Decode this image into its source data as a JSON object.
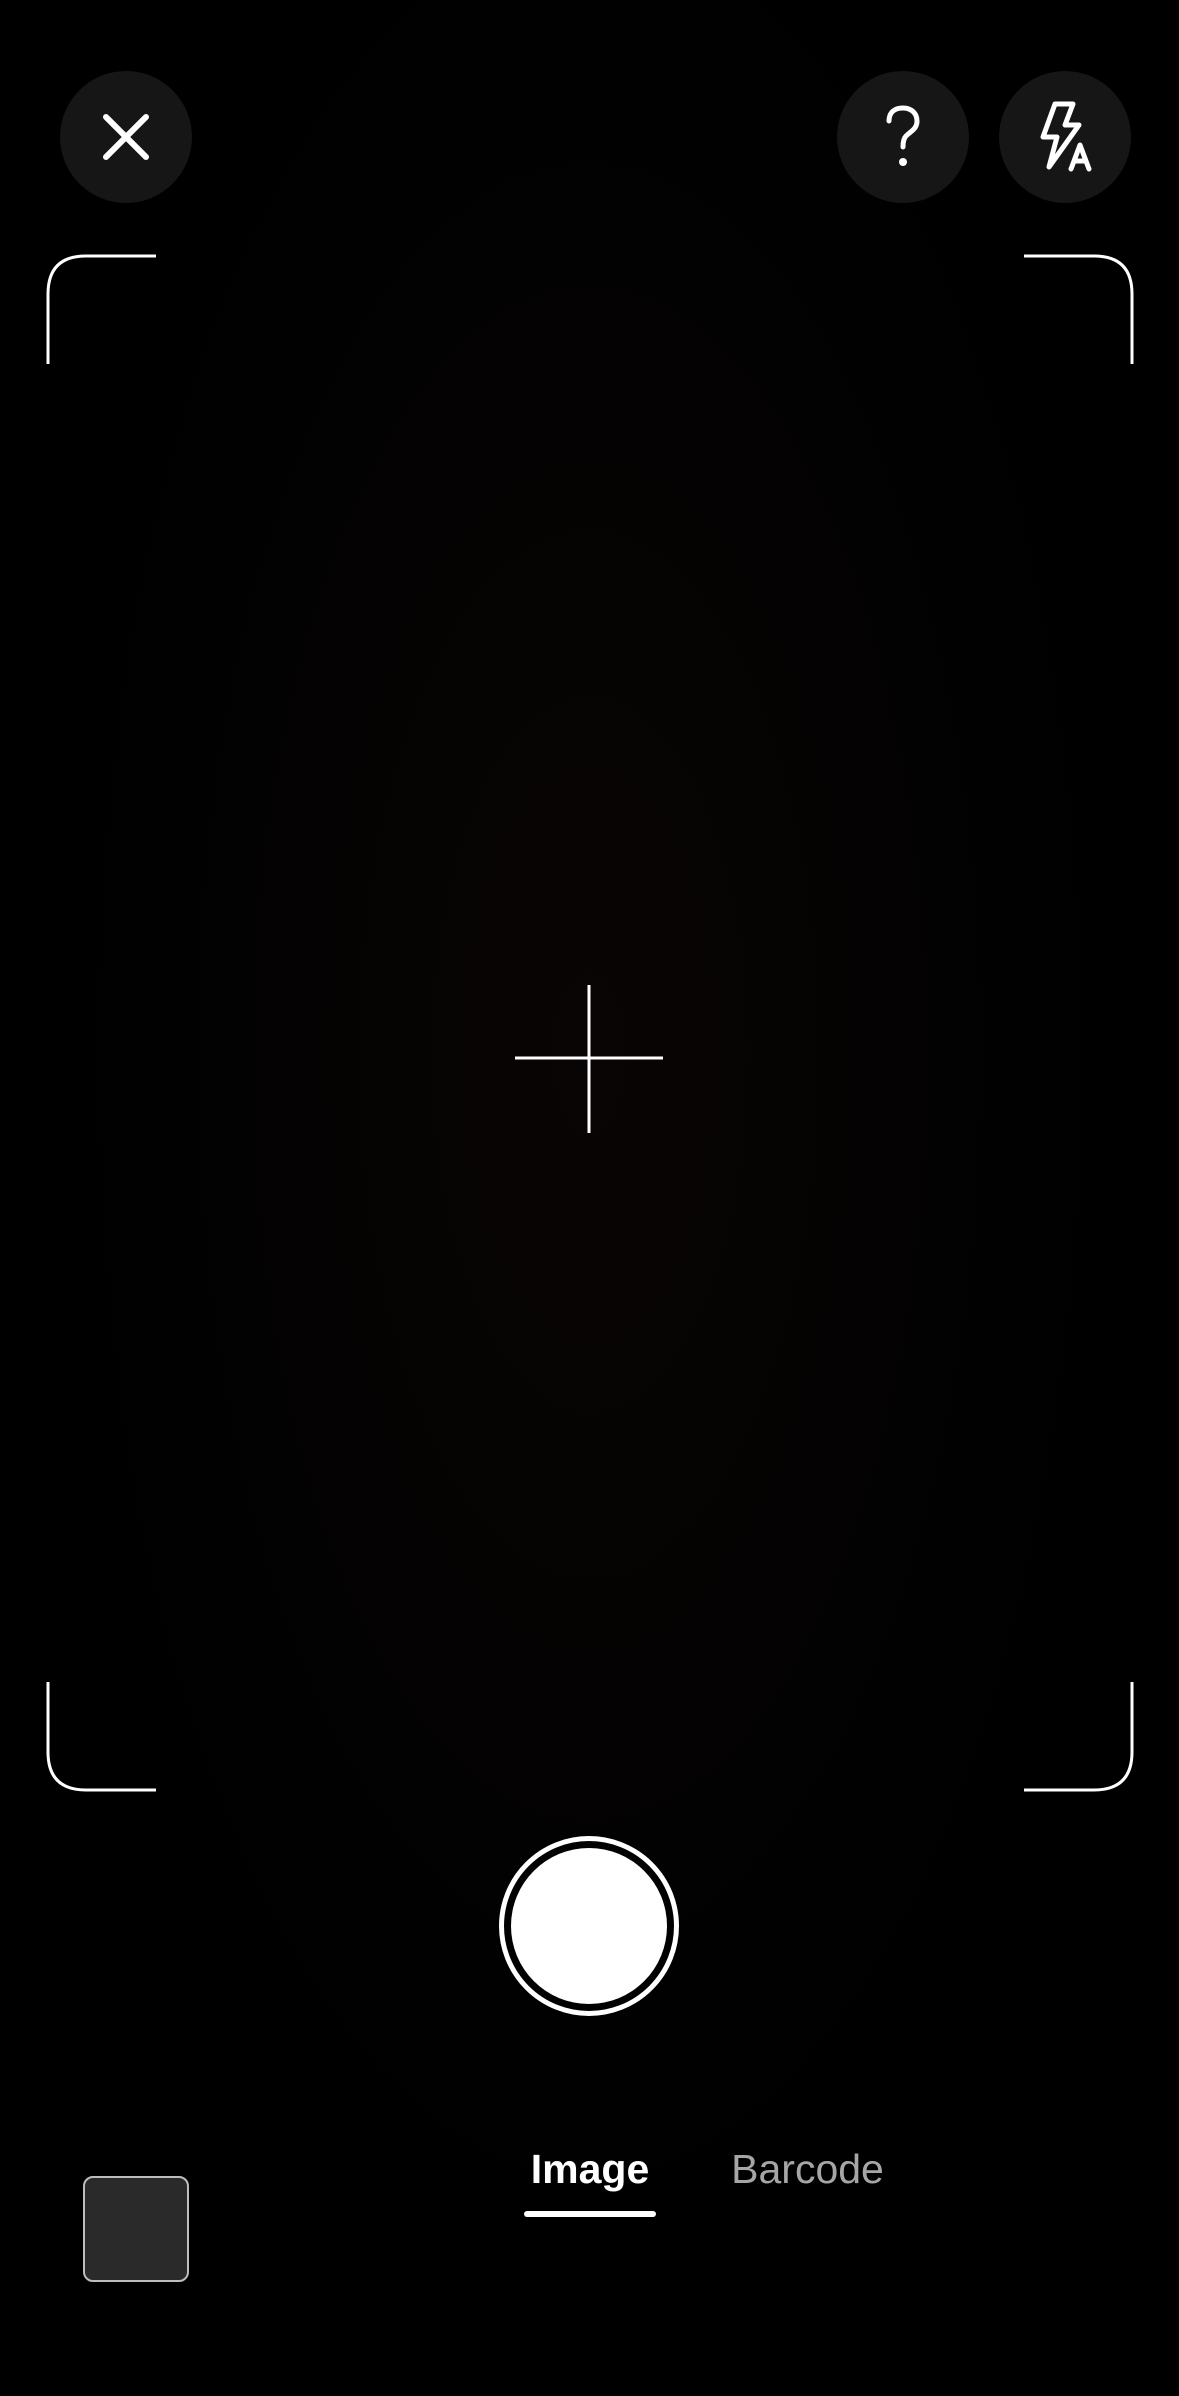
{
  "top_bar": {
    "close_icon": "close-icon",
    "help_icon": "help-icon",
    "flash_icon": "flash-auto-icon"
  },
  "viewfinder": {
    "crosshair_icon": "crosshair-icon"
  },
  "bottom_bar": {
    "shutter": "shutter-button",
    "gallery": "gallery-thumbnail",
    "modes": [
      {
        "label": "Image",
        "selected": true
      },
      {
        "label": "Barcode",
        "selected": false
      }
    ]
  },
  "colors": {
    "background": "#000000",
    "button_bg": "#161616",
    "foreground": "#ffffff",
    "inactive_tab": "#a6a6a6",
    "thumbnail": "#2a2a2a"
  }
}
